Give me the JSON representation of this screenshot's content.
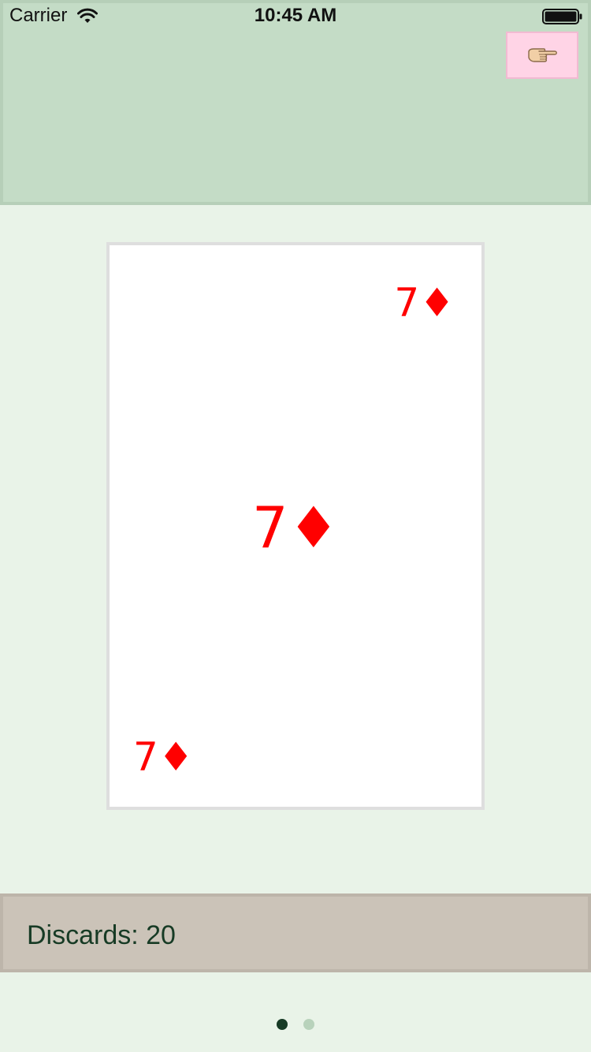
{
  "status_bar": {
    "carrier": "Carrier",
    "time": "10:45 AM",
    "wifi_icon": "wifi-icon",
    "battery_icon": "battery-full-icon"
  },
  "header": {
    "hint_button_icon": "pointing-hand-icon",
    "background_color": "#c4dcc6",
    "hint_button_color": "#ffd4e6"
  },
  "card": {
    "rank": "7",
    "suit_symbol": "♦",
    "suit": "diamonds",
    "corner_top": "7♦",
    "center": "7♦",
    "corner_bottom": "7♦",
    "suit_color": "#ff0000"
  },
  "discards": {
    "label": "Discards: 20"
  },
  "pager": {
    "page_count": 2,
    "current_page": 1
  }
}
